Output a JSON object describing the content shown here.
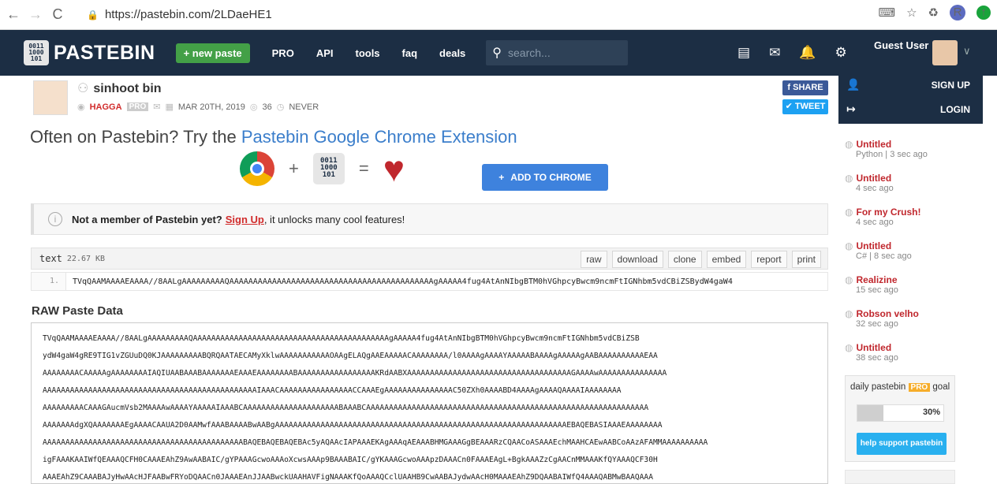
{
  "browser": {
    "url": "https://pastebin.com/2LDaeHE1",
    "back": "←",
    "forward": "→",
    "reload": "C",
    "profile_initial": "R"
  },
  "nav": {
    "logo_digits": "0011\n1000\n101",
    "logo_text": "PASTEBIN",
    "new_paste": "new paste",
    "links": [
      "PRO",
      "API",
      "tools",
      "faq",
      "deals"
    ],
    "search_placeholder": "search...",
    "guest": "Guest User"
  },
  "dropdown": {
    "signup": "SIGN UP",
    "login": "LOGIN"
  },
  "paste": {
    "title": "sinhoot bin",
    "user": "HAGGA",
    "pro": "PRO",
    "date": "MAR 20TH, 2019",
    "views": "36",
    "expire": "NEVER",
    "share": "SHARE",
    "tweet": "TWEET"
  },
  "promo": {
    "prefix": "Often on Pastebin? Try the ",
    "link": "Pastebin Google Chrome Extension",
    "plus": "+",
    "equals": "=",
    "add_to_chrome": "ADD TO CHROME"
  },
  "notice": {
    "prefix": "Not a member of Pastebin yet? ",
    "signup": "Sign Up",
    "suffix": ", it unlocks many cool features!"
  },
  "code": {
    "format": "text",
    "size": "22.67 KB",
    "actions": [
      "raw",
      "download",
      "clone",
      "embed",
      "report",
      "print"
    ],
    "line_number": "1.",
    "first_line": "TVqQAAMAAAAEAAAA//8AALgAAAAAAAAAQAAAAAAAAAAAAAAAAAAAAAAAAAAAAAAAAAAAAAAAAAAAgAAAAA4fug4AtAnNIbgBTM0hVGhpcyBwcm9ncmFtIGNhbm5vdCBiZSBydW4gaW4"
  },
  "raw": {
    "heading": "RAW Paste Data",
    "lines": [
      "TVqQAAMAAAAEAAAA//8AALgAAAAAAAAAQAAAAAAAAAAAAAAAAAAAAAAAAAAAAAAAAAAAAAAAAAAAgAAAAA4fug4AtAnNIbgBTM0hVGhpcyBwcm9ncmFtIGNhbm5vdCBiZSB",
      "ydW4gaW4gRE9TIG1vZGUuDQ0KJAAAAAAAAABQRQAATAECAMyXklwAAAAAAAAAAAOAAgELAQgAAEAAAAACAAAAAAAA/l0AAAAgAAAAYAAAAABAAAAgAAAAAgAABAAAAAAAAAAEAA",
      "AAAAAAAACAAAAAgAAAAAAAAIAQIUAABAAABAAAAAAAEAAAEAAAAAAAABAAAAAAAAAAAAAAAAAKRdAABXAAAAAAAAAAAAAAAAAAAAAAAAAAAAAAAAAAAAGAAAAwAAAAAAAAAAAAAAA",
      "AAAAAAAAAAAAAAAAAAAAAAAAAAAAAAAAAAAAAAAAAAAAAAAIAAACAAAAAAAAAAAAAAAACCAAAEgAAAAAAAAAAAAAAAC50ZXh0AAAABD4AAAAgAAAAQAAAAIAAAAAAAA",
      "AAAAAAAAACAAAGAucmVsb2MAAAAwAAAAYAAAAAIAAABCAAAAAAAAAAAAAAAAAAAAABAAABCAAAAAAAAAAAAAAAAAAAAAAAAAAAAAAAAAAAAAAAAAAAAAAAAAAAAAAAAAAAAAA",
      "AAAAAAAdgXQAAAAAAAEgAAAACAAUA2D0AAMwfAAABAAAABwAABgAAAAAAAAAAAAAAAAAAAAAAAAAAAAAAAAAAAAAAAAAAAAAAAAAAAAAAAAAAAAAAAAEBAQEBASIAAAEAAAAAAAA",
      "AAAAAAAAAAAAAAAAAAAAAAAAAAAAAAAAAAAAAAAAAAAABAQEBAQEBAQEBAc5yAQAAcIAPAAAEKAgAAAqAEAAABHMGAAAGgBEAAARzCQAACoASAAAEchMAAHCAEwAABCoAAzAFAMMAAAAAAAAAA",
      "igFAAAKAAIWfQEAAAQCFH0CAAAEAhZ9AwAABAIC/gYPAAAGcwoAAAoXcwsAAAp9BAAABAIC/gYKAAAGcwoAAApzDAAACn0FAAAEAgL+BgkAAAZzCgAACnMMAAAKfQYAAAQCF30H",
      "AAAEAhZ9CAAABAJyHwAAcHJFAABwFRYoDQAACn0JAAAEAnJJAABwckUAAHAVFigNAAAKfQoAAAQCclUAAHB9CwAABAJydwAAcH0MAAAEAhZ9DQAABAIWfQ4AAAQABMwBAAQAAA"
    ]
  },
  "sidebar": {
    "items": [
      {
        "title": "Untitled",
        "sub": "Python | 3 sec ago"
      },
      {
        "title": "Untitled",
        "sub": "4 sec ago"
      },
      {
        "title": "For my Crush!",
        "sub": "4 sec ago"
      },
      {
        "title": "Untitled",
        "sub": "C# | 8 sec ago"
      },
      {
        "title": "Realizine",
        "sub": "15 sec ago"
      },
      {
        "title": "Robson velho",
        "sub": "32 sec ago"
      },
      {
        "title": "Untitled",
        "sub": "38 sec ago"
      }
    ],
    "goal": {
      "prefix": "daily pastebin ",
      "pro": "PRO",
      "suffix": " goal",
      "percent": "30%",
      "progress": 0.3,
      "help": "help support pastebin"
    }
  }
}
